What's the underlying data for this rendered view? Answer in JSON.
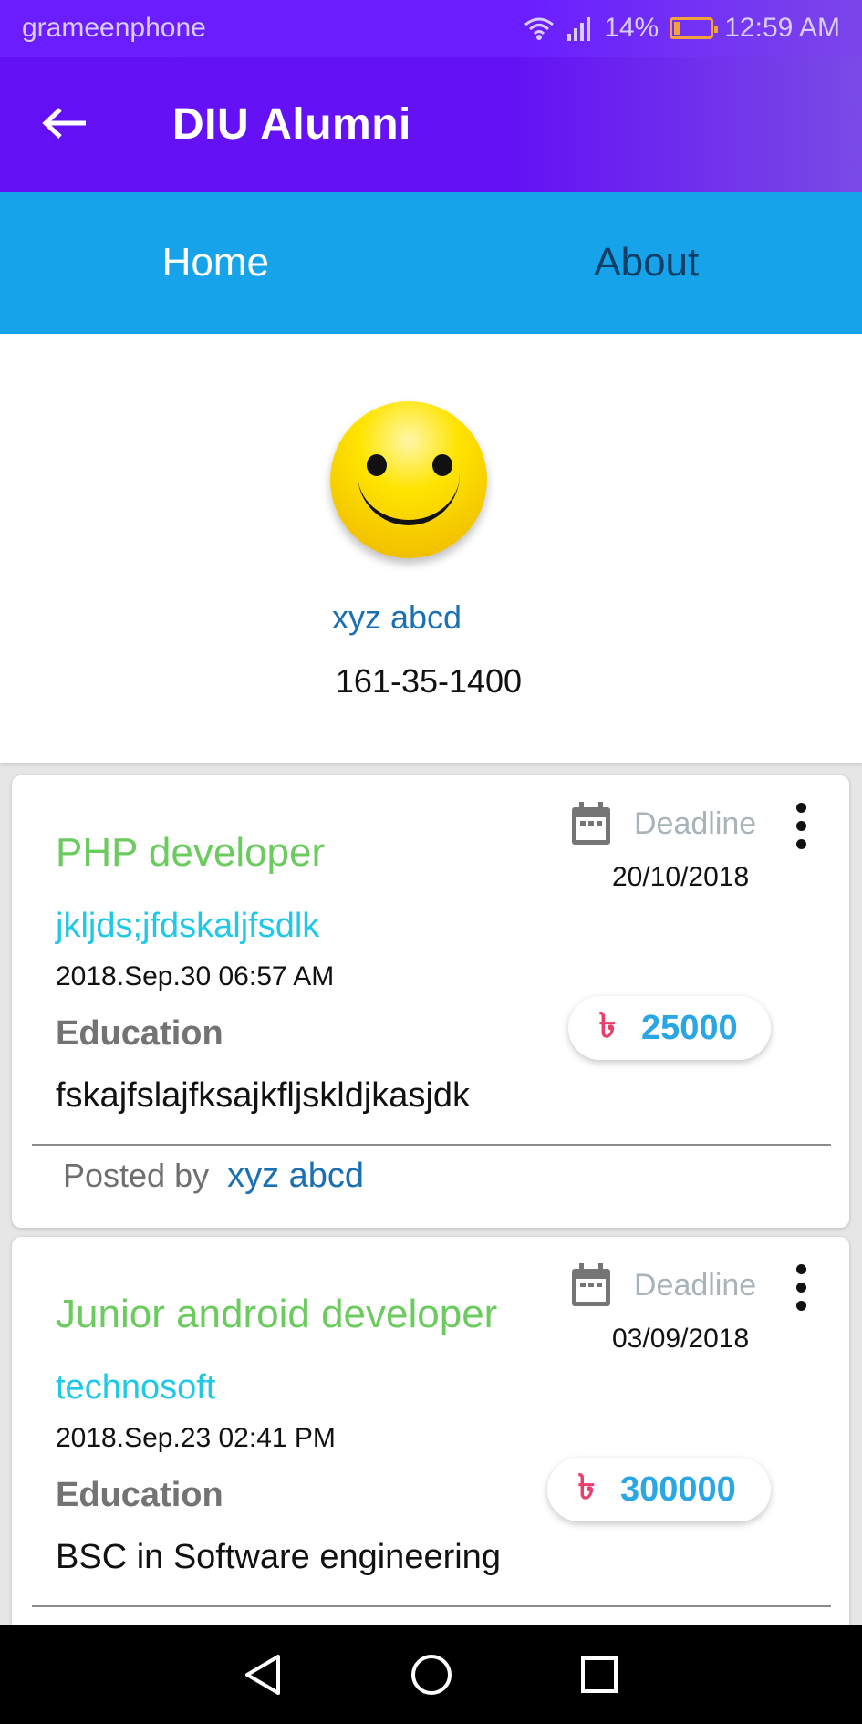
{
  "status_bar": {
    "carrier": "grameenphone",
    "battery": "14%",
    "time": "12:59 AM",
    "battery_level": 0.14,
    "icons": [
      "wifi-icon",
      "signal-icon",
      "battery-icon"
    ]
  },
  "app_bar": {
    "back_icon": "arrow-left-icon",
    "title": "DIU Alumni",
    "color": "#6410f5"
  },
  "tabs": [
    {
      "label": "Home"
    },
    {
      "label": "About"
    }
  ],
  "profile": {
    "avatar_icon": "smiley-face-icon",
    "name": "xyz abcd",
    "id": "161-35-1400"
  },
  "jobs": [
    {
      "title": "PHP developer",
      "company": "jkljds;jfdskaljfsdlk",
      "posted_at": "2018.Sep.30 06:57 AM",
      "education_label": "Education",
      "education": "fskajfslajfksajkfljskldjkasjdk",
      "deadline_label": "Deadline",
      "deadline": "20/10/2018",
      "currency_symbol": "৳",
      "salary": "25000",
      "posted_by_label": "Posted by",
      "posted_by": "xyz abcd"
    },
    {
      "title": "Junior android developer",
      "company": "technosoft",
      "posted_at": "2018.Sep.23 02:41 PM",
      "education_label": "Education",
      "education": "BSC in Software engineering",
      "deadline_label": "Deadline",
      "deadline": "03/09/2018",
      "currency_symbol": "৳",
      "salary": "300000"
    }
  ],
  "nav_bar": {
    "icons": [
      "back-triangle-icon",
      "home-circle-icon",
      "recents-square-icon"
    ]
  },
  "colors": {
    "accent": "#16a3ea",
    "title_green": "#6ccb5f",
    "company_cyan": "#1ec8e6",
    "salary_blue": "#2ba6e4",
    "taka_pink": "#ec3e6a"
  }
}
